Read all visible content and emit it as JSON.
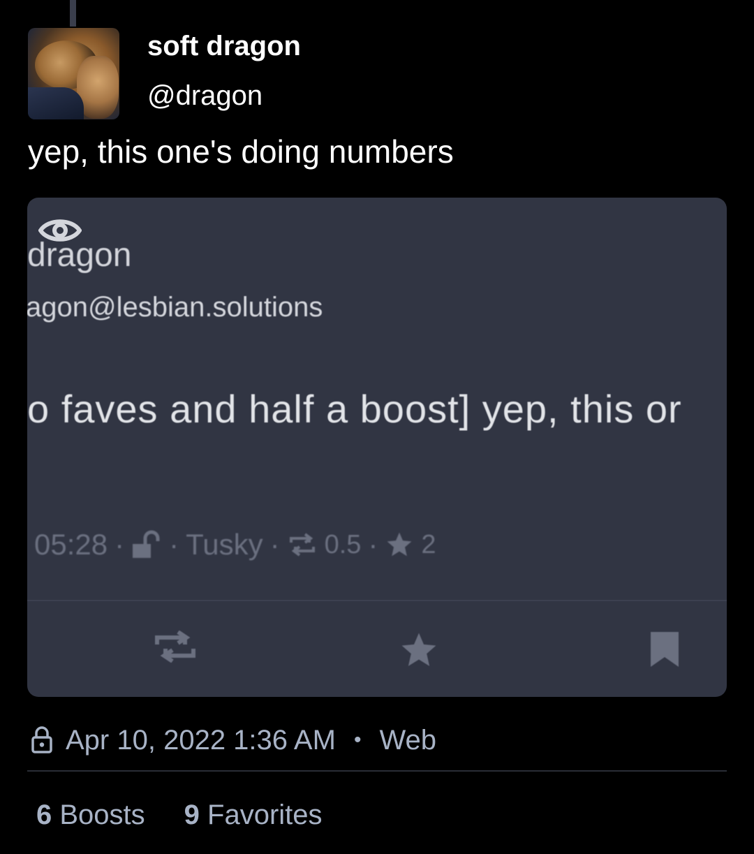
{
  "post": {
    "display_name": "soft dragon",
    "handle": "@dragon",
    "text": "yep, this one's doing numbers"
  },
  "quoted_screenshot": {
    "display_name": "dragon",
    "handle": "agon@lesbian.solutions",
    "text": "o faves and half a boost] yep, this or",
    "time": "05:28",
    "sep": "·",
    "client": "Tusky",
    "boosts": "0.5",
    "favorites": "2",
    "icons": [
      "eye-icon",
      "unlock-icon",
      "boost-icon",
      "star-icon",
      "bookmark-icon"
    ]
  },
  "detail": {
    "date": "Apr 10, 2022 1:36 AM",
    "separator": "•",
    "client": "Web",
    "icon": "lock-icon"
  },
  "stats": {
    "boosts_count": "6",
    "boosts_label": "Boosts",
    "favorites_count": "9",
    "favorites_label": "Favorites"
  },
  "colors": {
    "background": "#000000",
    "card": "#313543",
    "muted_text": "#a8b3c6",
    "quoted_muted": "#6b7080"
  }
}
